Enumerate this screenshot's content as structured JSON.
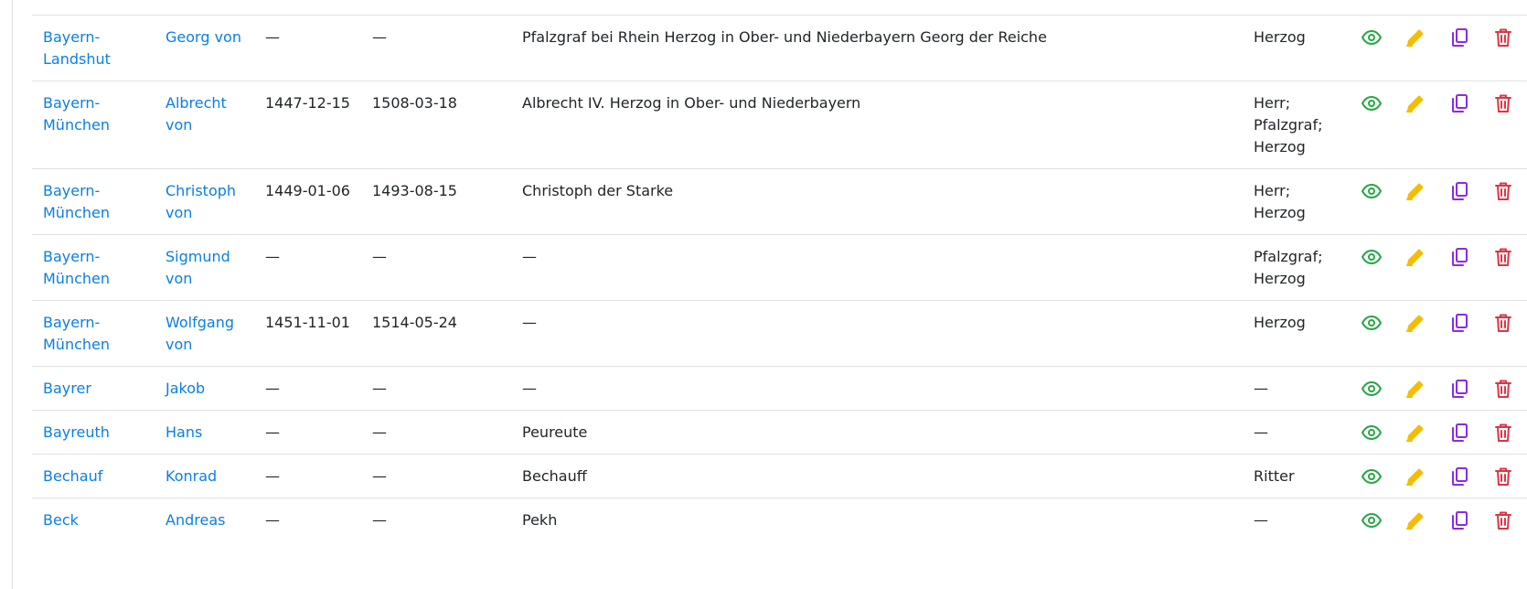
{
  "colors": {
    "link": "#0a7fe6",
    "view": "#28a745",
    "edit": "#f5bd00",
    "copy": "#8a2be2",
    "delete": "#dc3545",
    "border": "#dee2e6"
  },
  "icons": {
    "view": "eye-icon",
    "edit": "pencil-icon",
    "copy": "copy-icon",
    "delete": "trash-icon"
  },
  "rows": [
    {
      "family": "Bayern-Landshut",
      "given": "Georg von",
      "birth": "—",
      "death": "—",
      "variants": "Pfalzgraf bei Rhein Herzog in Ober- und Niederbayern Georg der Reiche",
      "title": "Herzog"
    },
    {
      "family": "Bayern-München",
      "given": "Albrecht von",
      "birth": "1447-12-15",
      "death": "1508-03-18",
      "variants": "Albrecht IV. Herzog in Ober- und Niederbayern",
      "title": "Herr; Pfalzgraf; Herzog"
    },
    {
      "family": "Bayern-München",
      "given": "Christoph von",
      "birth": "1449-01-06",
      "death": "1493-08-15",
      "variants": "Christoph der Starke",
      "title": "Herr; Herzog"
    },
    {
      "family": "Bayern-München",
      "given": "Sigmund von",
      "birth": "—",
      "death": "—",
      "variants": "—",
      "title": "Pfalzgraf; Herzog"
    },
    {
      "family": "Bayern-München",
      "given": "Wolfgang von",
      "birth": "1451-11-01",
      "death": "1514-05-24",
      "variants": "—",
      "title": "Herzog"
    },
    {
      "family": "Bayrer",
      "given": "Jakob",
      "birth": "—",
      "death": "—",
      "variants": "—",
      "title": "—"
    },
    {
      "family": "Bayreuth",
      "given": "Hans",
      "birth": "—",
      "death": "—",
      "variants": "Peureute",
      "title": "—"
    },
    {
      "family": "Bechauf",
      "given": "Konrad",
      "birth": "—",
      "death": "—",
      "variants": "Bechauff",
      "title": "Ritter"
    },
    {
      "family": "Beck",
      "given": "Andreas",
      "birth": "—",
      "death": "—",
      "variants": "Pekh",
      "title": "—"
    }
  ]
}
